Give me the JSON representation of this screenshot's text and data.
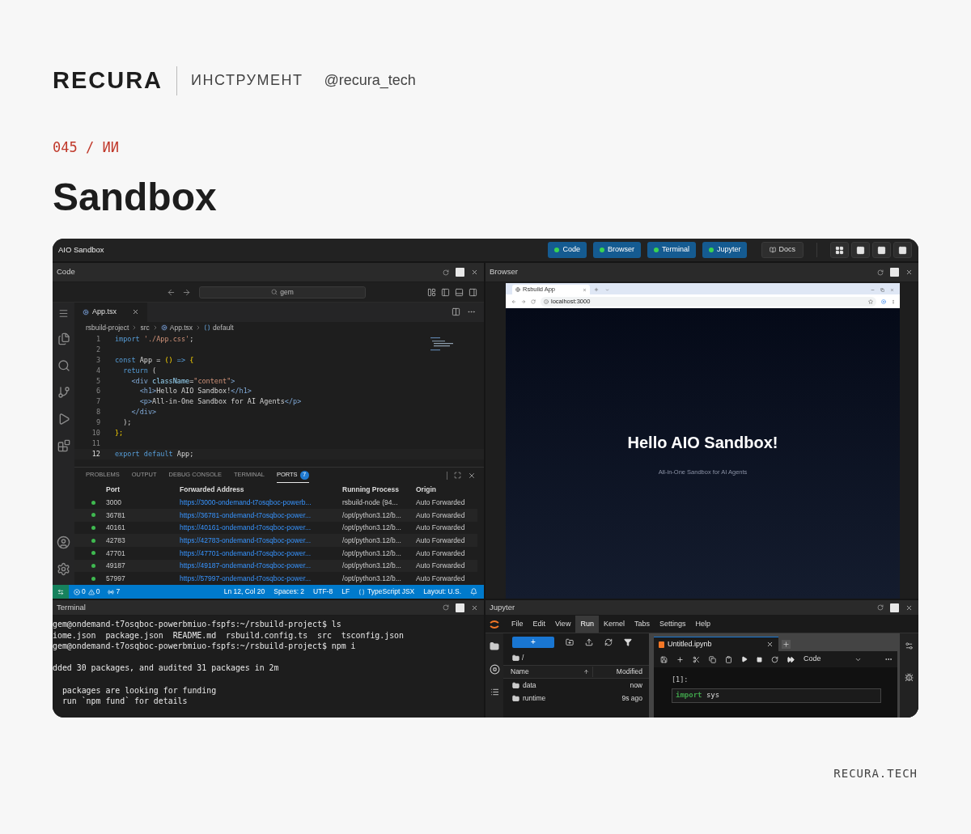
{
  "brand": {
    "logo": "RECURA",
    "category": "ИНСТРУМЕНТ",
    "handle": "@recura_tech"
  },
  "issue": "045 / ИИ",
  "title": "Sandbox",
  "window": {
    "title": "AIO Sandbox",
    "panel_buttons": [
      {
        "label": "Code",
        "on": true
      },
      {
        "label": "Browser",
        "on": true
      },
      {
        "label": "Terminal",
        "on": true
      },
      {
        "label": "Jupyter",
        "on": true
      }
    ],
    "docs_button": "Docs",
    "layout_buttons": [
      {
        "kind": "grid"
      },
      {
        "kind": "columns"
      },
      {
        "kind": "rows"
      },
      {
        "kind": "single"
      }
    ]
  },
  "code_panel": {
    "title": "Code",
    "search": "gem",
    "tab": "App.tsx",
    "breadcrumb": [
      {
        "label": "rsbuild-project",
        "kind": "folder"
      },
      {
        "label": "src",
        "kind": "folder"
      },
      {
        "label": "App.tsx",
        "kind": "file"
      },
      {
        "label": "default",
        "kind": "symbol"
      }
    ],
    "lines": [
      {
        "number": "1",
        "current": false,
        "tokens": [
          {
            "text": "import",
            "kind": "keyword"
          },
          {
            "text": " './App.css'",
            "kind": "string"
          },
          {
            "text": ";",
            "kind": "plain"
          }
        ]
      },
      {
        "number": "2",
        "current": false
      },
      {
        "number": "3",
        "current": false,
        "tokens": [
          {
            "text": "const",
            "kind": "keyword"
          },
          {
            "text": " App = ",
            "kind": "plain"
          },
          {
            "text": "()",
            "kind": "bracket"
          },
          {
            "text": " =>",
            "kind": "keyword"
          },
          {
            "text": " {",
            "kind": "bracket"
          }
        ]
      },
      {
        "number": "4",
        "current": false,
        "tokens": [
          {
            "text": "  return",
            "kind": "keyword"
          },
          {
            "text": " (",
            "kind": "plain"
          }
        ]
      },
      {
        "number": "5",
        "current": false,
        "tokens": [
          {
            "text": "    <div",
            "kind": "tag"
          },
          {
            "text": " className",
            "kind": "attr"
          },
          {
            "text": "=",
            "kind": "plain"
          },
          {
            "text": "\"content\"",
            "kind": "string"
          },
          {
            "text": ">",
            "kind": "tag"
          }
        ]
      },
      {
        "number": "6",
        "current": false,
        "tokens": [
          {
            "text": "      <h1>",
            "kind": "tag"
          },
          {
            "text": "Hello AIO Sandbox!",
            "kind": "plain"
          },
          {
            "text": "</h1>",
            "kind": "tag"
          }
        ]
      },
      {
        "number": "7",
        "current": false,
        "tokens": [
          {
            "text": "      <p>",
            "kind": "tag"
          },
          {
            "text": "All-in-One Sandbox for AI Agents",
            "kind": "plain"
          },
          {
            "text": "</p>",
            "kind": "tag"
          }
        ]
      },
      {
        "number": "8",
        "current": false,
        "tokens": [
          {
            "text": "    </div>",
            "kind": "tag"
          }
        ]
      },
      {
        "number": "9",
        "current": false,
        "tokens": [
          {
            "text": "  );",
            "kind": "plain"
          }
        ]
      },
      {
        "number": "10",
        "current": false,
        "tokens": [
          {
            "text": "};",
            "kind": "bracket"
          }
        ]
      },
      {
        "number": "11",
        "current": false
      },
      {
        "number": "12",
        "current": true,
        "tokens": [
          {
            "text": "export default",
            "kind": "keyword"
          },
          {
            "text": " App;",
            "kind": "plain"
          }
        ]
      }
    ],
    "panel_tabs": [
      {
        "label": "PROBLEMS",
        "selected": false
      },
      {
        "label": "OUTPUT",
        "selected": false
      },
      {
        "label": "DEBUG CONSOLE",
        "selected": false
      },
      {
        "label": "TERMINAL",
        "selected": false
      },
      {
        "label": "PORTS",
        "selected": true,
        "badge": "7"
      }
    ],
    "ports": {
      "columns": [
        "Port",
        "Forwarded Address",
        "Running Process",
        "Origin"
      ],
      "rows": [
        {
          "port": "3000",
          "address": "https://3000-ondemand-t7osqboc-powerb...",
          "process": "rsbuild-node (94...",
          "origin": "Auto Forwarded"
        },
        {
          "port": "36781",
          "address": "https://36781-ondemand-t7osqboc-power...",
          "process": "/opt/python3.12/b...",
          "origin": "Auto Forwarded"
        },
        {
          "port": "40161",
          "address": "https://40161-ondemand-t7osqboc-power...",
          "process": "/opt/python3.12/b...",
          "origin": "Auto Forwarded"
        },
        {
          "port": "42783",
          "address": "https://42783-ondemand-t7osqboc-power...",
          "process": "/opt/python3.12/b...",
          "origin": "Auto Forwarded"
        },
        {
          "port": "47701",
          "address": "https://47701-ondemand-t7osqboc-power...",
          "process": "/opt/python3.12/b...",
          "origin": "Auto Forwarded"
        },
        {
          "port": "49187",
          "address": "https://49187-ondemand-t7osqboc-power...",
          "process": "/opt/python3.12/b...",
          "origin": "Auto Forwarded"
        },
        {
          "port": "57997",
          "address": "https://57997-ondemand-t7osqboc-power...",
          "process": "/opt/python3.12/b...",
          "origin": "Auto Forwarded"
        }
      ]
    },
    "status_bar": {
      "errors": "0",
      "warnings": "0",
      "ports": "7",
      "position": "Ln 12, Col 20",
      "spaces": "Spaces: 2",
      "encoding": "UTF-8",
      "eol": "LF",
      "language": "TypeScript JSX",
      "layout": "Layout: U.S."
    }
  },
  "browser_panel": {
    "title": "Browser",
    "tab": "Rsbuild App",
    "url": "localhost:3000",
    "heading": "Hello AIO Sandbox!",
    "subtitle": "All-in-One Sandbox for AI Agents"
  },
  "terminal_panel": {
    "title": "Terminal",
    "lines": [
      {
        "kind": "text",
        "text": "gem@ondemand-t7osqboc-powerbmiuo-fspfs:~/rsbuild-project$ ls"
      },
      {
        "kind": "text",
        "text": "iome.json  package.json  README.md  rsbuild.config.ts  src  tsconfig.json"
      },
      {
        "kind": "text",
        "text": "gem@ondemand-t7osqboc-powerbmiuo-fspfs:~/rsbuild-project$ npm i"
      },
      {
        "kind": "blank"
      },
      {
        "kind": "text",
        "text": "dded 30 packages, and audited 31 packages in 2m"
      },
      {
        "kind": "blank"
      },
      {
        "kind": "text",
        "text": "  packages are looking for funding"
      },
      {
        "kind": "text",
        "text": "  run `npm fund` for details"
      }
    ]
  },
  "jupyter_panel": {
    "title": "Jupyter",
    "menu": [
      {
        "label": "File",
        "selected": false
      },
      {
        "label": "Edit",
        "selected": false
      },
      {
        "label": "View",
        "selected": false
      },
      {
        "label": "Run",
        "selected": true
      },
      {
        "label": "Kernel",
        "selected": false
      },
      {
        "label": "Tabs",
        "selected": false
      },
      {
        "label": "Settings",
        "selected": false
      },
      {
        "label": "Help",
        "selected": false
      }
    ],
    "new_button": "+",
    "path": "/",
    "columns": [
      "Name",
      "Modified"
    ],
    "files": [
      {
        "name": "data",
        "modified": "now"
      },
      {
        "name": "runtime",
        "modified": "9s ago"
      }
    ],
    "notebook_tab": "Untitled.ipynb",
    "cell_type": "Code",
    "cell_prompt": "[1]:",
    "cell_code": [
      {
        "text": "import",
        "kind": "keyword"
      },
      {
        "text": " sys",
        "kind": "plain"
      }
    ]
  },
  "footer": "RECURA.TECH"
}
